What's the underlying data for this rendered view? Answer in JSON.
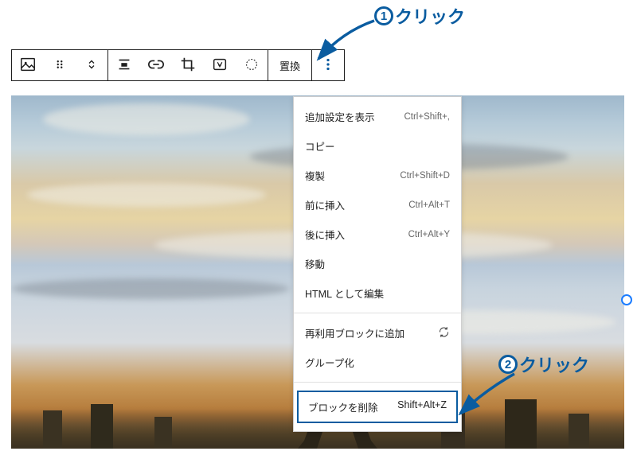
{
  "toolbar": {
    "replace_label": "置換"
  },
  "menu": {
    "section1": [
      {
        "label": "追加設定を表示",
        "shortcut": "Ctrl+Shift+,"
      },
      {
        "label": "コピー",
        "shortcut": ""
      },
      {
        "label": "複製",
        "shortcut": "Ctrl+Shift+D"
      },
      {
        "label": "前に挿入",
        "shortcut": "Ctrl+Alt+T"
      },
      {
        "label": "後に挿入",
        "shortcut": "Ctrl+Alt+Y"
      },
      {
        "label": "移動",
        "shortcut": ""
      },
      {
        "label": "HTML として編集",
        "shortcut": ""
      }
    ],
    "section2": [
      {
        "label": "再利用ブロックに追加",
        "shortcut": "",
        "icon": "refresh"
      },
      {
        "label": "グループ化",
        "shortcut": ""
      }
    ],
    "section3": {
      "label": "ブロックを削除",
      "shortcut": "Shift+Alt+Z"
    }
  },
  "annotations": {
    "a1_num": "1",
    "a1_text": "クリック",
    "a2_num": "2",
    "a2_text": "クリック"
  }
}
